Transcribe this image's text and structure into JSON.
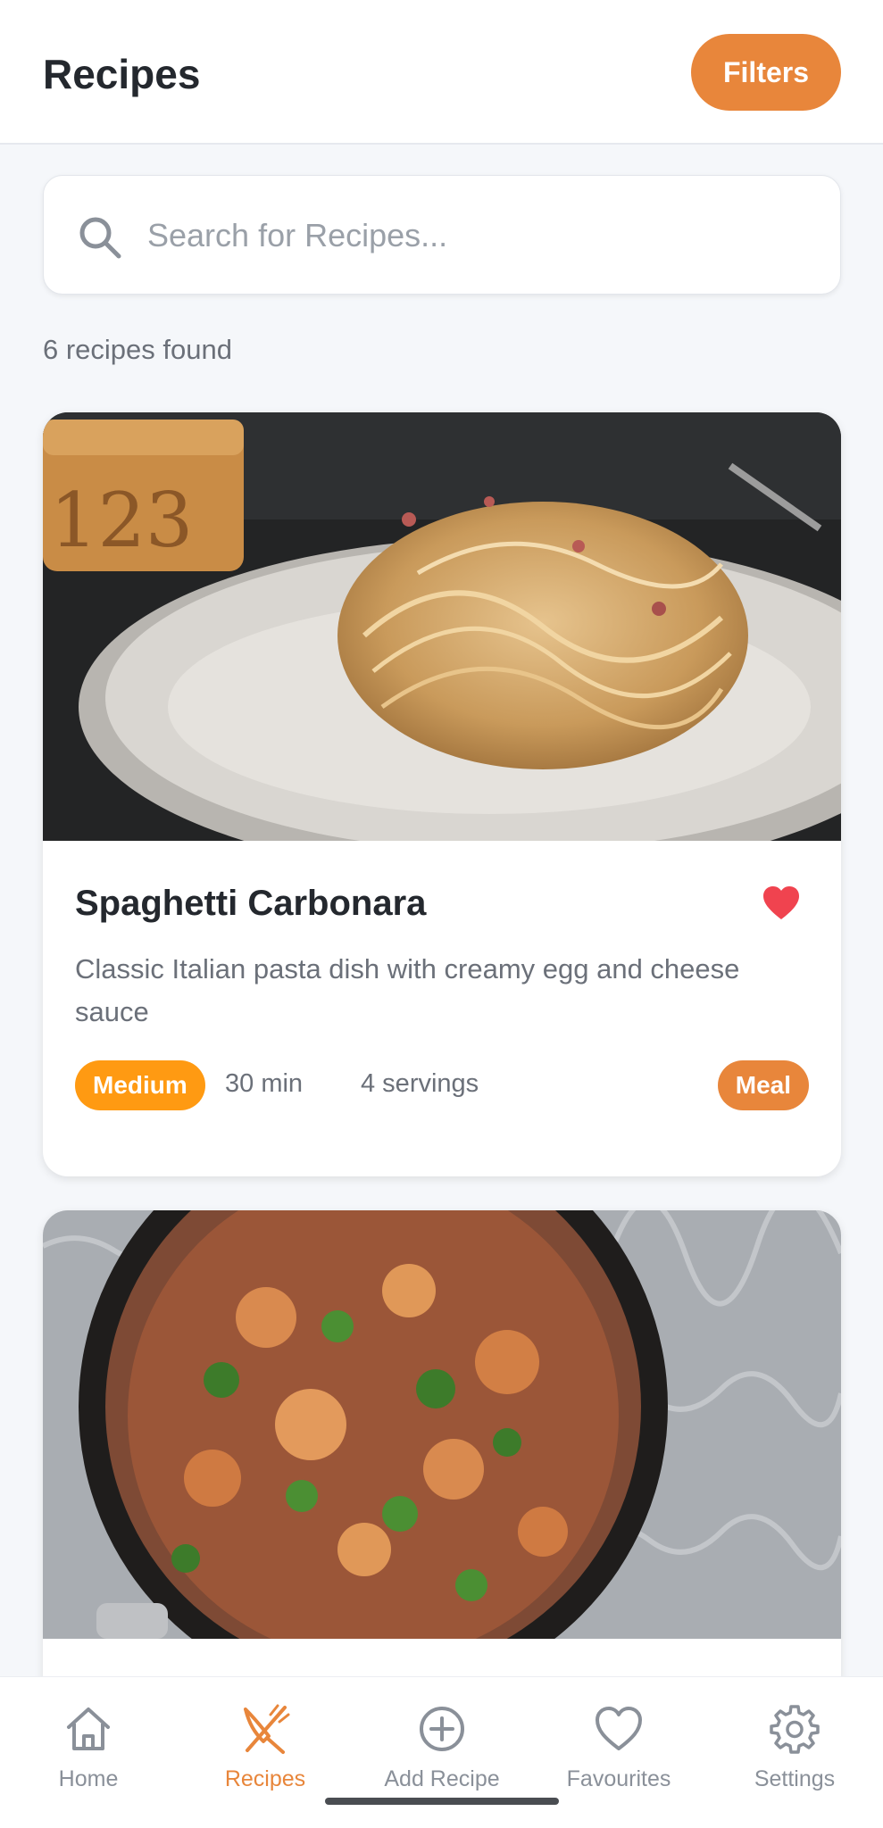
{
  "header": {
    "title": "Recipes",
    "filters_label": "Filters"
  },
  "search": {
    "placeholder": "Search for Recipes..."
  },
  "result_count": "6 recipes found",
  "recipes": [
    {
      "title": "Spaghetti Carbonara",
      "description": "Classic Italian pasta dish with creamy egg and cheese sauce",
      "difficulty": "Medium",
      "time": "30 min",
      "servings": "4 servings",
      "category": "Meal",
      "favourite": true
    },
    {
      "title": "",
      "description": ""
    }
  ],
  "nav": {
    "home": "Home",
    "recipes": "Recipes",
    "add_recipe": "Add Recipe",
    "favourites": "Favourites",
    "settings": "Settings",
    "active": "recipes"
  },
  "colors": {
    "accent": "#e8863b",
    "difficulty_badge": "#ff9a12",
    "favourite_heart": "#f0434f",
    "text_primary": "#24282e",
    "text_secondary": "#6b7079",
    "background": "#f5f7fa"
  },
  "icons": {
    "search": "search-icon",
    "favourite": "heart-icon",
    "home": "home-icon",
    "recipes": "fork-knife-icon",
    "add_recipe": "plus-circle-icon",
    "favourites": "heart-outline-icon",
    "settings": "gear-icon"
  }
}
